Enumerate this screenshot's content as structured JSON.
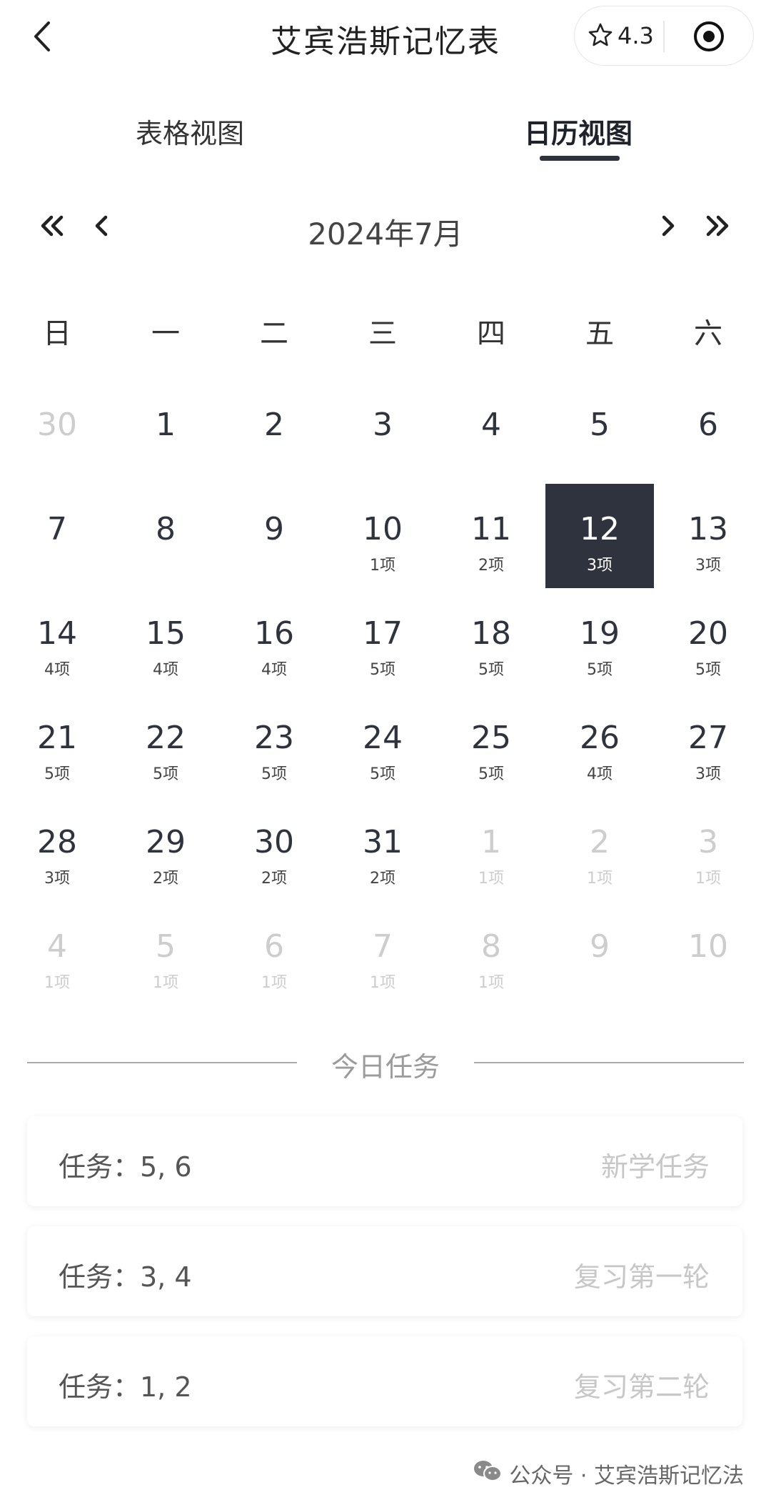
{
  "header": {
    "title": "艾宾浩斯记忆表",
    "rating": "4.3"
  },
  "tabs": [
    {
      "label": "表格视图"
    },
    {
      "label": "日历视图"
    }
  ],
  "calendar": {
    "month_title": "2024年7月",
    "weekdays": [
      "日",
      "一",
      "二",
      "三",
      "四",
      "五",
      "六"
    ],
    "rows": [
      [
        {
          "d": "30",
          "c": "",
          "o": true
        },
        {
          "d": "1",
          "c": ""
        },
        {
          "d": "2",
          "c": ""
        },
        {
          "d": "3",
          "c": ""
        },
        {
          "d": "4",
          "c": ""
        },
        {
          "d": "5",
          "c": ""
        },
        {
          "d": "6",
          "c": ""
        }
      ],
      [
        {
          "d": "7",
          "c": ""
        },
        {
          "d": "8",
          "c": ""
        },
        {
          "d": "9",
          "c": ""
        },
        {
          "d": "10",
          "c": "1项"
        },
        {
          "d": "11",
          "c": "2项"
        },
        {
          "d": "12",
          "c": "3项",
          "s": true
        },
        {
          "d": "13",
          "c": "3项"
        }
      ],
      [
        {
          "d": "14",
          "c": "4项"
        },
        {
          "d": "15",
          "c": "4项"
        },
        {
          "d": "16",
          "c": "4项"
        },
        {
          "d": "17",
          "c": "5项"
        },
        {
          "d": "18",
          "c": "5项"
        },
        {
          "d": "19",
          "c": "5项"
        },
        {
          "d": "20",
          "c": "5项"
        }
      ],
      [
        {
          "d": "21",
          "c": "5项"
        },
        {
          "d": "22",
          "c": "5项"
        },
        {
          "d": "23",
          "c": "5项"
        },
        {
          "d": "24",
          "c": "5项"
        },
        {
          "d": "25",
          "c": "5项"
        },
        {
          "d": "26",
          "c": "4项"
        },
        {
          "d": "27",
          "c": "3项"
        }
      ],
      [
        {
          "d": "28",
          "c": "3项"
        },
        {
          "d": "29",
          "c": "2项"
        },
        {
          "d": "30",
          "c": "2项"
        },
        {
          "d": "31",
          "c": "2项"
        },
        {
          "d": "1",
          "c": "1项",
          "o": true
        },
        {
          "d": "2",
          "c": "1项",
          "o": true
        },
        {
          "d": "3",
          "c": "1项",
          "o": true
        }
      ],
      [
        {
          "d": "4",
          "c": "1项",
          "o": true
        },
        {
          "d": "5",
          "c": "1项",
          "o": true
        },
        {
          "d": "6",
          "c": "1项",
          "o": true
        },
        {
          "d": "7",
          "c": "1项",
          "o": true
        },
        {
          "d": "8",
          "c": "1项",
          "o": true
        },
        {
          "d": "9",
          "c": "",
          "o": true
        },
        {
          "d": "10",
          "c": "",
          "o": true
        }
      ]
    ]
  },
  "today": {
    "heading": "今日任务",
    "tasks": [
      {
        "label": "任务：5, 6",
        "type": "新学任务"
      },
      {
        "label": "任务：3, 4",
        "type": "复习第一轮"
      },
      {
        "label": "任务：1, 2",
        "type": "复习第二轮"
      }
    ]
  },
  "footer": {
    "text": "公众号 · 艾宾浩斯记忆法"
  },
  "colors": {
    "accent": "#2f333d",
    "muted": "#cdcdcd",
    "task_type": "#c7c7c7"
  }
}
